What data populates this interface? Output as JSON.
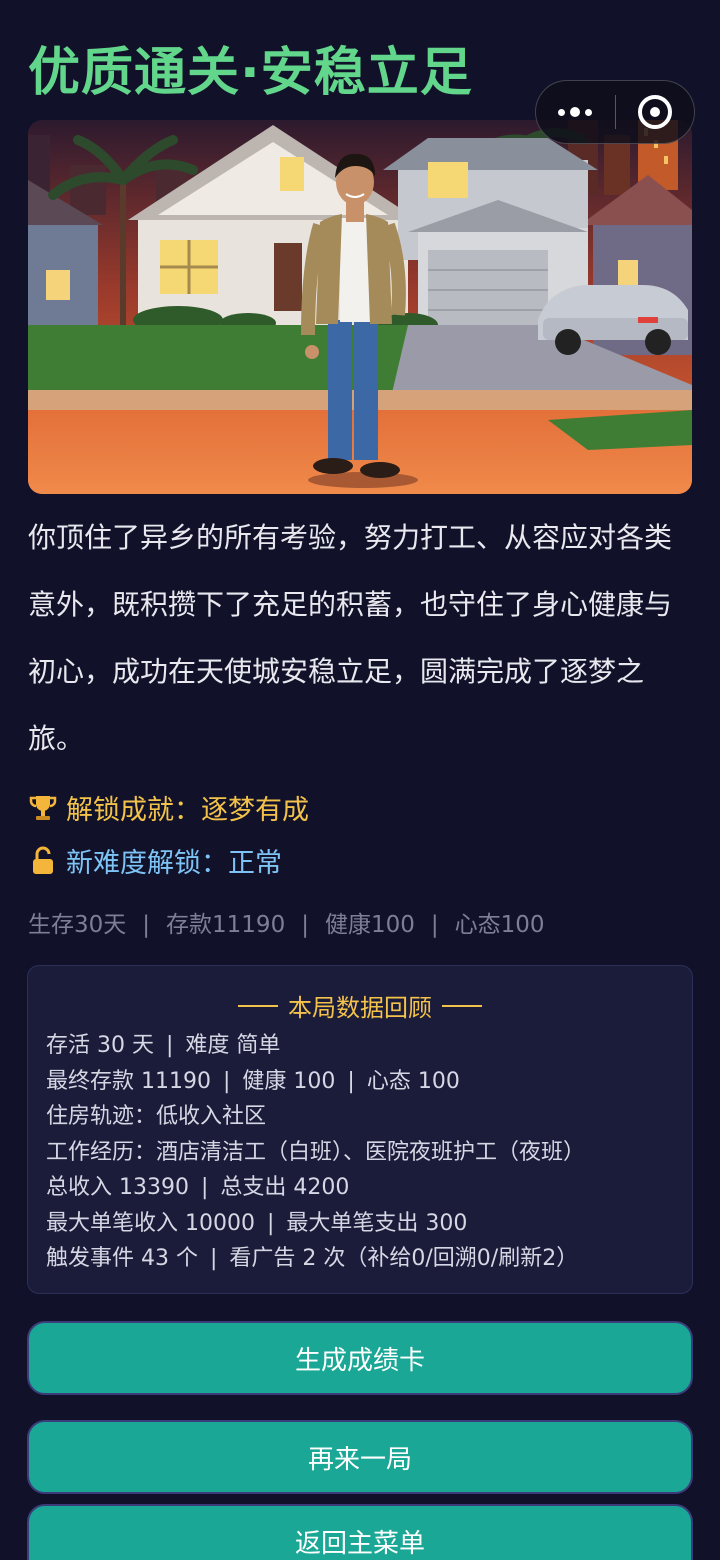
{
  "header": {
    "title": "优质通关·安稳立足"
  },
  "capsule": {
    "menu_icon": "more-dots-icon",
    "close_icon": "target-circle-icon"
  },
  "hero": {
    "image": "man-standing-in-front-of-house-at-sunset",
    "colors": {
      "sky_top": "#2c1a2e",
      "sky_bottom": "#e8682f",
      "accent": "#62d68a"
    }
  },
  "story": {
    "text": "你顶住了异乡的所有考验，努力打工、从容应对各类意外，既积攒下了充足的积蓄，也守住了身心健康与初心，成功在天使城安稳立足，圆满完成了逐梦之旅。"
  },
  "achievements": {
    "achievement": {
      "icon": "trophy-icon",
      "label": "解锁成就：逐梦有成"
    },
    "difficulty": {
      "icon": "unlock-icon",
      "label": "新难度解锁：正常"
    }
  },
  "stats": [
    "生存30天",
    "存款11190",
    "健康100",
    "心态100"
  ],
  "review": {
    "title": "本局数据回顾",
    "line1": {
      "a": "存活 30 天",
      "b": "难度 简单"
    },
    "line2": {
      "a": "最终存款 11190",
      "b": "健康 100",
      "c": "心态 100"
    },
    "line3": "住房轨迹：低收入社区",
    "line4": "工作经历：酒店清洁工（白班）、医院夜班护工（夜班）",
    "line5": {
      "a": "总收入 13390",
      "b": "总支出 4200"
    },
    "line6": {
      "a": "最大单笔收入 10000",
      "b": "最大单笔支出 300"
    },
    "line7": {
      "a": "触发事件 43 个",
      "b": "看广告 2 次（补给0/回溯0/刷新2）"
    }
  },
  "buttons": {
    "score_card": "生成成绩卡",
    "replay": "再来一局",
    "main_menu": "返回主菜单"
  }
}
